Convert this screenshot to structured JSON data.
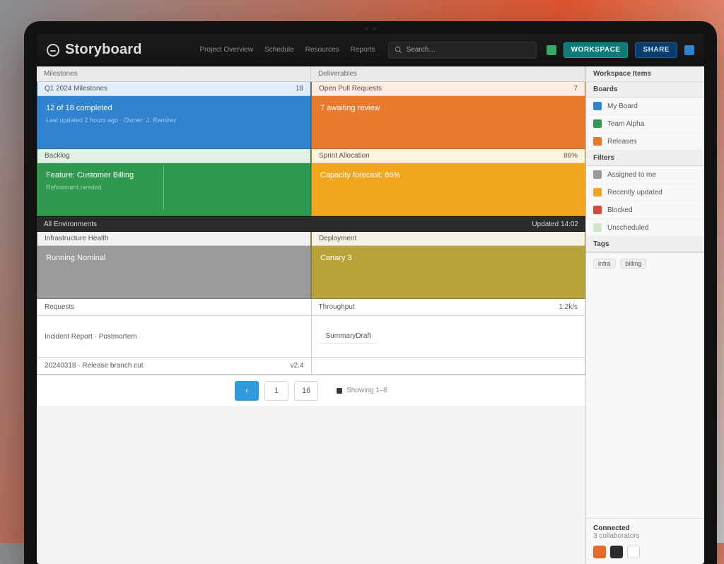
{
  "app": {
    "title": "Storyboard"
  },
  "topnav": [
    "Project Overview",
    "Schedule",
    "Resources",
    "Reports"
  ],
  "search": {
    "placeholder": "Search…"
  },
  "top_buttons": {
    "a": "WORKSPACE",
    "b": "SHARE"
  },
  "columns": {
    "left": "Milestones",
    "right": "Deliverables"
  },
  "rows": [
    {
      "left": {
        "head": "Q1 2024 Milestones",
        "line1": "12 of 18 completed",
        "line2": "Last updated 2 hours ago · Owner: J. Ramirez",
        "color": "blue-bg",
        "head_right": "18"
      },
      "right": {
        "head": "Open Pull Requests",
        "line1": "7 awaiting review",
        "color": "orange-bg",
        "head_right": "7"
      }
    },
    {
      "left": {
        "head": "Backlog",
        "line1": "Feature: Customer Billing",
        "line2": "Refinement needed",
        "color": "green-bg",
        "head_right": ""
      },
      "right": {
        "head": "Sprint Allocation",
        "line1": "Capacity forecast: 86%",
        "color": "amber-bg",
        "head_right": "86%"
      }
    }
  ],
  "darkstrip": {
    "left": "All Environments",
    "right": "Updated 14:02"
  },
  "rows2": [
    {
      "left": {
        "head": "Infrastructure Health",
        "line1": "Running Nominal",
        "color": "gray-bg"
      },
      "right": {
        "head": "Deployment",
        "line1": "Canary 3",
        "color": "olive-bg"
      }
    }
  ],
  "thin": [
    {
      "left_a": "Requests",
      "left_b": "",
      "right_a": "Throughput",
      "right_b": "1.2k/s"
    },
    {
      "left_a": "Incident Report · Postmortem",
      "left_b": "",
      "right_a": "",
      "right_b": ""
    }
  ],
  "mint": {
    "head": "Summary",
    "right_meta": "Draft"
  },
  "footer_row": {
    "left": "20240318 · Release branch cut",
    "right": "v2.4"
  },
  "pager": {
    "prev": "‹",
    "page": "1",
    "total": "16",
    "meta": "Showing 1–8"
  },
  "sidebar": {
    "title": "Workspace Items",
    "groups": [
      {
        "label": "Boards",
        "items": [
          {
            "label": "My Board",
            "color": "#2f83cf"
          },
          {
            "label": "Team Alpha",
            "color": "#2f9a4f"
          },
          {
            "label": "Releases",
            "color": "#e77a2d"
          }
        ]
      },
      {
        "label": "Filters",
        "items": [
          {
            "label": "Assigned to me",
            "color": "#9a9a9a"
          },
          {
            "label": "Recently updated",
            "color": "#f0a71f"
          },
          {
            "label": "Blocked",
            "color": "#d94a3a"
          },
          {
            "label": "Unscheduled",
            "color": "#cfe6c9"
          }
        ]
      },
      {
        "label": "Tags",
        "items": [
          {
            "label": "infra",
            "color": "#666"
          },
          {
            "label": "billing",
            "color": "#666"
          }
        ]
      }
    ],
    "status": {
      "label": "Connected",
      "detail": "3 collaborators"
    }
  }
}
